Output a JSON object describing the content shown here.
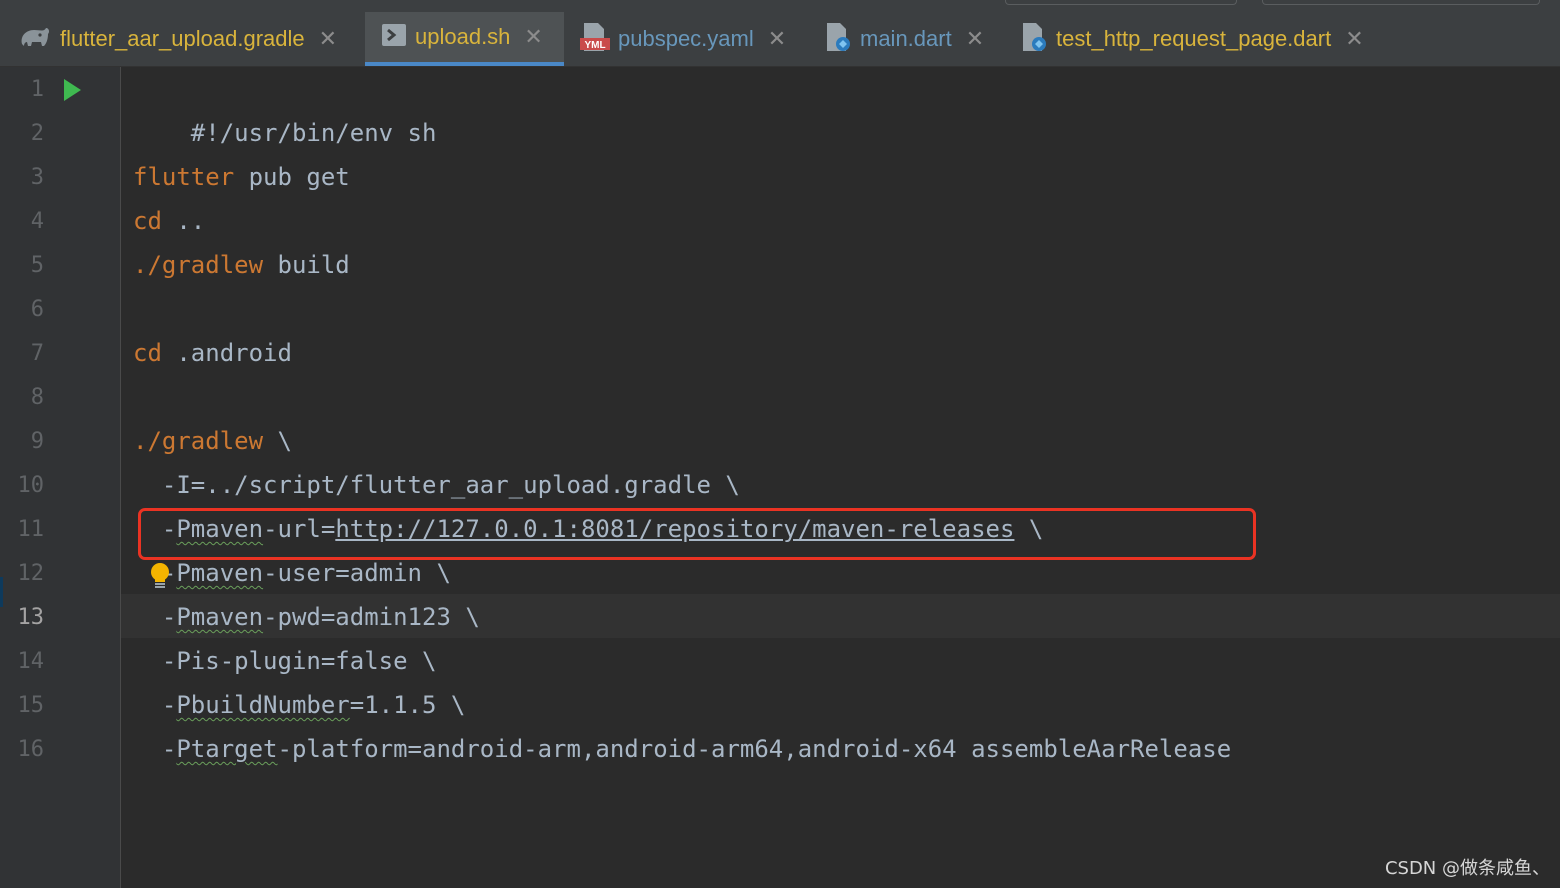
{
  "tabs": [
    {
      "label": "flutter_aar_upload.gradle",
      "icon": "gradle-elephant-icon",
      "active": false,
      "color": "#d9b43c"
    },
    {
      "label": "upload.sh",
      "icon": "shell-script-icon",
      "active": true,
      "color": "#d9b43c"
    },
    {
      "label": "pubspec.yaml",
      "icon": "yaml-file-icon",
      "active": false,
      "color": "#6897bb"
    },
    {
      "label": "main.dart",
      "icon": "dart-file-icon",
      "active": false,
      "color": "#6897bb"
    },
    {
      "label": "test_http_request_page.dart",
      "icon": "dart-file-icon",
      "active": false,
      "color": "#d9b43c"
    }
  ],
  "tab_close_glyph": "✕",
  "line_numbers": [
    "1",
    "2",
    "3",
    "4",
    "5",
    "6",
    "7",
    "8",
    "9",
    "10",
    "11",
    "12",
    "13",
    "14",
    "15",
    "16"
  ],
  "current_line": "13",
  "code": {
    "l1": "#!/usr/bin/env sh",
    "l3_kw": "flutter",
    "l3_rest": " pub get",
    "l4_kw": "cd",
    "l4_rest": " ..",
    "l5_kw": "./gradlew",
    "l5_rest": " build",
    "l7_kw": "cd",
    "l7_rest": " .android",
    "l9_kw": "./gradlew",
    "l9_rest": " \\",
    "l10": "  -I=../script/flutter_aar_upload.gradle \\",
    "l11_a": "  -",
    "l11_b": "Pmaven",
    "l11_c": "-url=",
    "l11_url": "http://127.0.0.1:8081/repository/maven-releases",
    "l11_d": " \\",
    "l12_a": "  -",
    "l12_b": "Pmaven",
    "l12_c": "-user=admin \\",
    "l13_a": "  -",
    "l13_b": "Pmaven",
    "l13_c": "-pwd=admin123 \\",
    "l14": "  -Pis-plugin=false \\",
    "l15_a": "  -",
    "l15_b": "PbuildNumber",
    "l15_c": "=1.1.5 \\",
    "l16_a": "  -",
    "l16_b": "Ptarget",
    "l16_c": "-platform=android-arm,android-arm64,android-x64 assembleAarRelease"
  },
  "colors": {
    "background": "#2b2b2b",
    "keyword": "#cc7832",
    "text": "#a9b7c6",
    "highlight_box": "#ea3323",
    "run": "#3fb950",
    "bulb": "#f4b400"
  },
  "watermark": "CSDN @做条咸鱼、"
}
